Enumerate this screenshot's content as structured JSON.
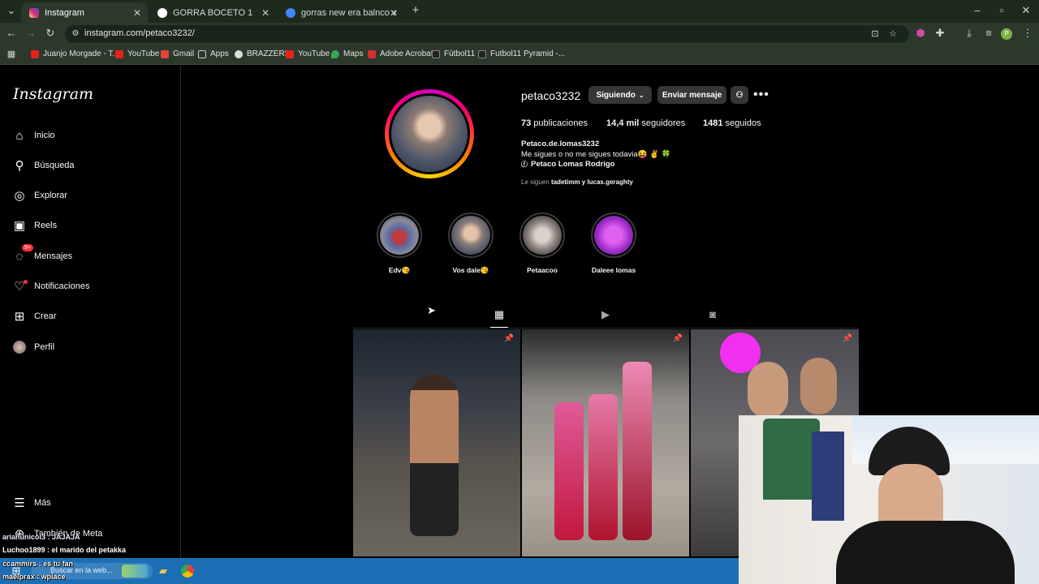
{
  "browser": {
    "tabs": [
      {
        "label": "Instagram",
        "active": true
      },
      {
        "label": "GORRA BOCETO 1",
        "active": false
      },
      {
        "label": "gorras new era balnco verde - B",
        "active": false
      }
    ],
    "new_tab": "+",
    "url": "instagram.com/petaco3232/",
    "bookmarks": [
      "Juanjo Morgade - T...",
      "YouTube",
      "Gmail",
      "Apps",
      "BRAZZERS",
      "YouTube",
      "Maps",
      "Adobe Acrobat",
      "Fútbol11",
      "Futbol11 Pyramid -..."
    ]
  },
  "sidebar": {
    "logo": "Instagram",
    "items": [
      {
        "label": "Inicio",
        "icon": "home-icon"
      },
      {
        "label": "Búsqueda",
        "icon": "search-icon"
      },
      {
        "label": "Explorar",
        "icon": "compass-icon"
      },
      {
        "label": "Reels",
        "icon": "reels-icon"
      },
      {
        "label": "Mensajes",
        "icon": "messenger-icon",
        "badge": "9+"
      },
      {
        "label": "Notificaciones",
        "icon": "heart-icon"
      },
      {
        "label": "Crear",
        "icon": "plus-square-icon"
      },
      {
        "label": "Perfil",
        "icon": "avatar"
      }
    ],
    "more": "Más",
    "meta": "También de Meta"
  },
  "profile": {
    "username": "petaco3232",
    "following_button": "Siguiendo",
    "message_button": "Enviar mensaje",
    "stats": {
      "posts_value": "73",
      "posts_label": "publicaciones",
      "followers_value": "14,4 mil",
      "followers_label": "seguidores",
      "following_value": "1481",
      "following_label": "seguidos"
    },
    "bio": {
      "name": "Petaco.de.lomas3232",
      "line": "Me sigues o no me sigues todavia😝 ✌️ 🍀",
      "facebook": "Petaco Lomas Rodrigo"
    },
    "followed_by": {
      "prefix": "Le siguen",
      "users": "tadetimm y lucas.geraghty"
    }
  },
  "highlights": [
    {
      "label": "Edv😘"
    },
    {
      "label": "Vos dale😘"
    },
    {
      "label": "Petaacoo"
    },
    {
      "label": "Daleee lomas"
    }
  ],
  "chat": [
    {
      "text": "arianunicol3 : JAJAJA"
    },
    {
      "text": "Luchoo1899 : el marido del petakka"
    },
    {
      "text": "ccammirs : es tu fan"
    },
    {
      "text": "maelprax : wplace"
    }
  ],
  "taskbar": {
    "search_placeholder": "Buscar en la web..."
  },
  "colors": {
    "accent": "#0095f6",
    "button_bg": "#363636",
    "badge": "#ff3040",
    "taskbar": "#1c6fb4"
  }
}
